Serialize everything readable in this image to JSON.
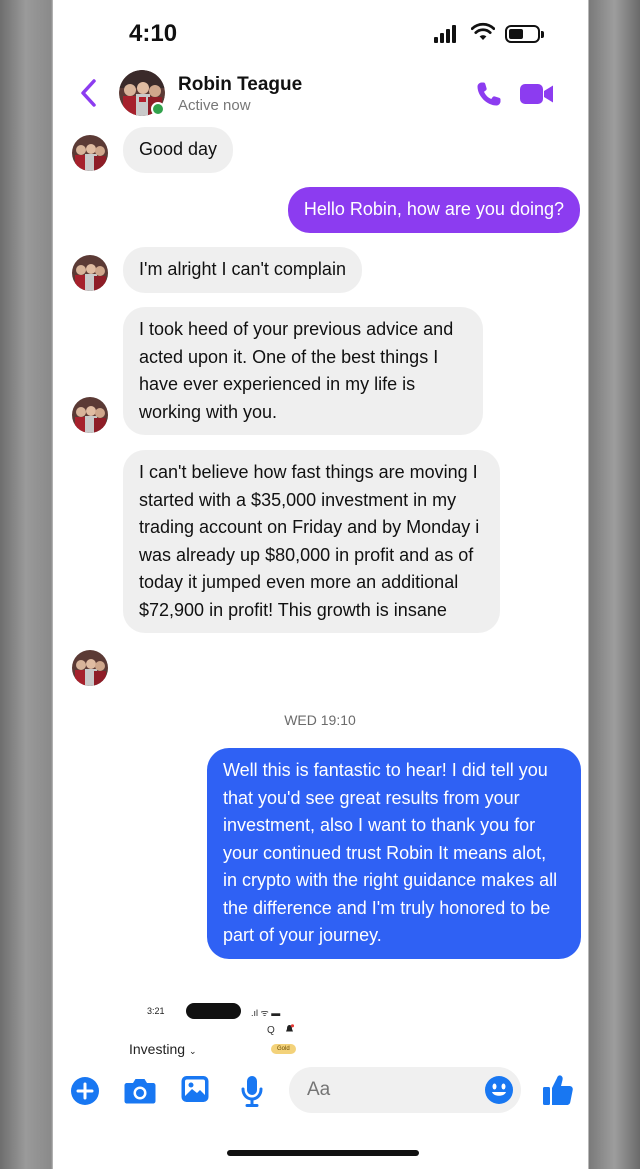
{
  "status_bar": {
    "time": "4:10"
  },
  "header": {
    "contact_name": "Robin Teague",
    "contact_status": "Active now"
  },
  "messages": [
    {
      "text": "Good day"
    },
    {
      "text": "Hello Robin, how are you doing?"
    },
    {
      "text": "I'm alright I can't complain"
    },
    {
      "text": "I took heed of your previous advice and acted upon it. One of the best things I have ever experienced in my life is working with you."
    },
    {
      "text": "I can't believe how fast things are moving I started with a $35,000 investment in my trading account on Friday and by Monday i was already up $80,000 in profit and as of today it jumped even more an additional $72,900 in profit! This growth is insane"
    },
    {
      "text": "Well this is fantastic to hear! I did tell you that you'd see great results from your investment, also I want to thank you for your continued trust Robin It means alot, in crypto with the right guidance makes all the difference and I'm truly honored to be part of your journey."
    }
  ],
  "timestamp": "WED 19:10",
  "embedded_screenshot": {
    "time": "3:21",
    "status": ".ıl ᯤ ▬",
    "search": "Q",
    "tab_label": "Investing",
    "chevron": "⌄",
    "badge": "Gold"
  },
  "composer": {
    "placeholder": "Aa"
  },
  "colors": {
    "accent_purple": "#8c3cf0",
    "accent_blue": "#2f61f4",
    "incoming_bubble": "#efefef",
    "online": "#31a24c"
  },
  "icons": [
    "back-chevron-icon",
    "phone-icon",
    "video-camera-icon",
    "plus-icon",
    "camera-icon",
    "photo-icon",
    "microphone-icon",
    "emoji-icon",
    "thumbs-up-icon"
  ]
}
